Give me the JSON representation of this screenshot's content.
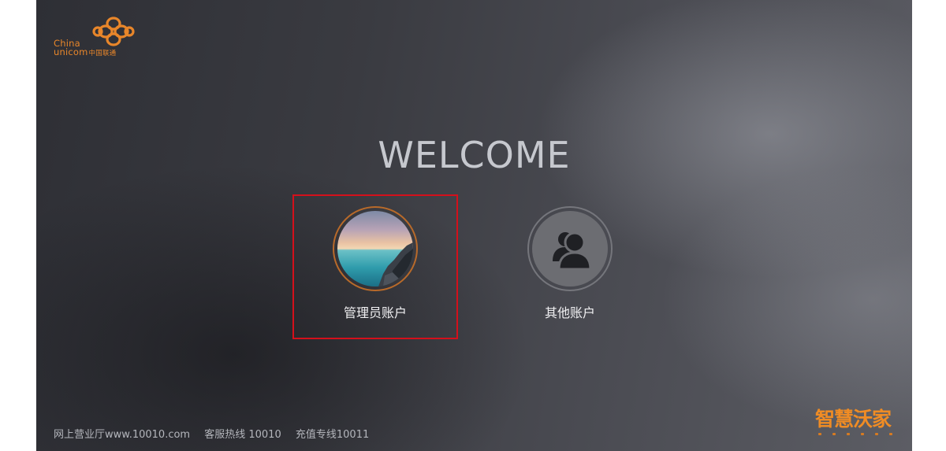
{
  "logo": {
    "name_en_line1": "China",
    "name_en_line2": "unicom",
    "name_cn": "中国联通",
    "icon": "china-unicom-knot-icon",
    "color": "#e8862a"
  },
  "welcome": {
    "title": "WELCOME"
  },
  "accounts": [
    {
      "label": "管理员账户",
      "avatar": "landscape-photo",
      "selected": true
    },
    {
      "label": "其他账户",
      "avatar": "users-icon",
      "selected": false
    }
  ],
  "footer": {
    "service_hall": "网上营业厅www.10010.com",
    "hotline": "客服热线 10010",
    "recharge": "充值专线10011"
  },
  "brand": {
    "name": "智慧沃家",
    "color": "#f08c24"
  },
  "colors": {
    "selection_outline": "#d4101b",
    "admin_ring": "#b86a2a"
  }
}
